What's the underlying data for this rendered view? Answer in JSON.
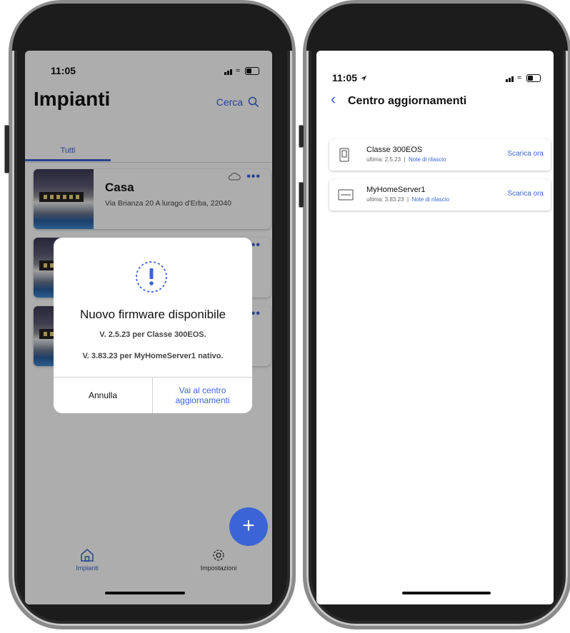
{
  "left": {
    "status_time": "11:05",
    "title": "Impianti",
    "search_label": "Cerca",
    "tab_all": "Tutti",
    "card": {
      "title": "Casa",
      "address": "Via Brianza 20 A lurago d'Erba, 22040",
      "more": "•••"
    },
    "dialog": {
      "title": "Nuovo firmware disponibile",
      "line1": "V. 2.5.23 per Classe 300EOS.",
      "line2": "V. 3.83.23 per MyHomeServer1 nativo.",
      "cancel": "Annulla",
      "go_line1": "Vai al centro",
      "go_line2": "aggiornamenti"
    },
    "fab_label": "+",
    "nav": {
      "home": "Impianti",
      "settings": "Impostazioni"
    }
  },
  "right": {
    "status_time": "11:05",
    "title": "Centro aggiornamenti",
    "items": [
      {
        "name": "Classe 300EOS",
        "latest": "ultima: 2.5.23",
        "sep": "|",
        "notes": "Note di rilascio",
        "download": "Scarica ora"
      },
      {
        "name": "MyHomeServer1",
        "latest": "ultima: 3.83.23",
        "sep": "|",
        "notes": "Note di rilascio",
        "download": "Scarica ora"
      }
    ]
  },
  "colors": {
    "accent": "#3b64d6",
    "overlay": "rgba(0,0,0,0.32)"
  }
}
